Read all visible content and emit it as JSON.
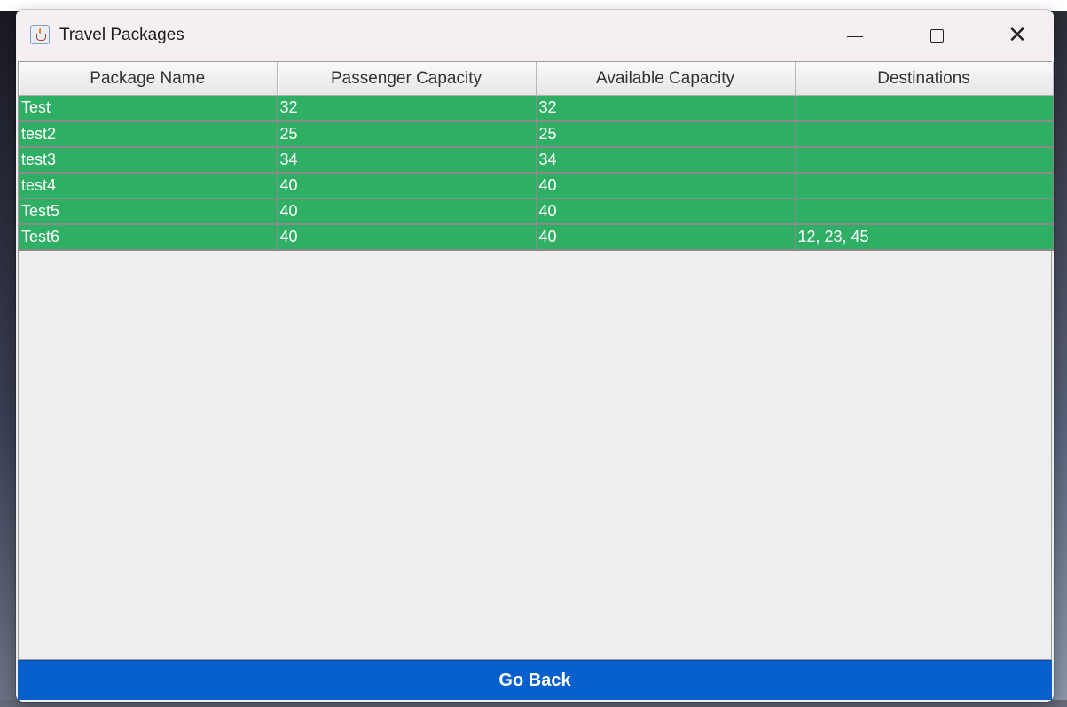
{
  "window": {
    "title": "Travel Packages"
  },
  "table": {
    "columns": [
      "Package Name",
      "Passenger Capacity",
      "Available Capacity",
      "Destinations"
    ],
    "rows": [
      [
        "Test",
        "32",
        "32",
        ""
      ],
      [
        "test2",
        "25",
        "25",
        ""
      ],
      [
        "test3",
        "34",
        "34",
        ""
      ],
      [
        "test4",
        "40",
        "40",
        ""
      ],
      [
        "Test5",
        "40",
        "40",
        ""
      ],
      [
        "Test6",
        "40",
        "40",
        "12, 23, 45"
      ]
    ],
    "row_color": "#2eaf64"
  },
  "footer": {
    "go_back_label": "Go Back",
    "button_color": "#0860cc"
  },
  "icons": {
    "app": "java-cup-icon",
    "minimize": "minimize-icon",
    "maximize": "maximize-icon",
    "close": "close-icon"
  }
}
